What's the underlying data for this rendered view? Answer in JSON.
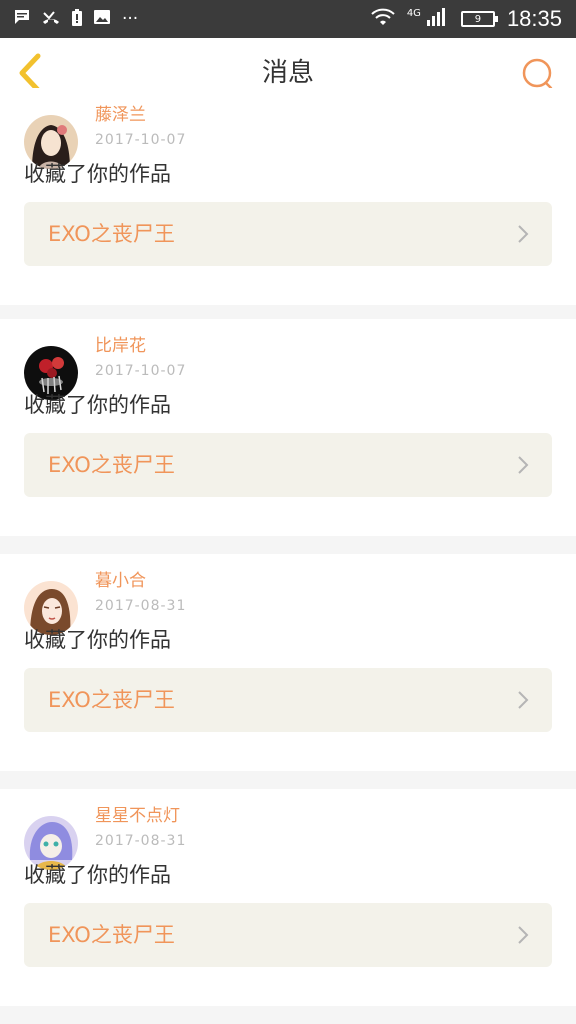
{
  "status_bar": {
    "left_icons": [
      "message-icon",
      "missed-call-icon",
      "battery-alert-icon",
      "image-icon",
      "more-icon"
    ],
    "network": "4G",
    "battery_level": "9",
    "time": "18:35"
  },
  "header": {
    "title": "消息"
  },
  "colors": {
    "accent": "#f0955a",
    "back_arrow": "#f2c12e",
    "card_link_bg": "#f3f2ea"
  },
  "messages": [
    {
      "username": "藤泽兰",
      "date": "2017-10-07",
      "action": "收藏了你的作品",
      "work_title": "EXO之丧尸王"
    },
    {
      "username": "比岸花",
      "date": "2017-10-07",
      "action": "收藏了你的作品",
      "work_title": "EXO之丧尸王"
    },
    {
      "username": "暮小合",
      "date": "2017-08-31",
      "action": "收藏了你的作品",
      "work_title": "EXO之丧尸王"
    },
    {
      "username": "星星不点灯",
      "date": "2017-08-31",
      "action": "收藏了你的作品",
      "work_title": "EXO之丧尸王"
    }
  ]
}
